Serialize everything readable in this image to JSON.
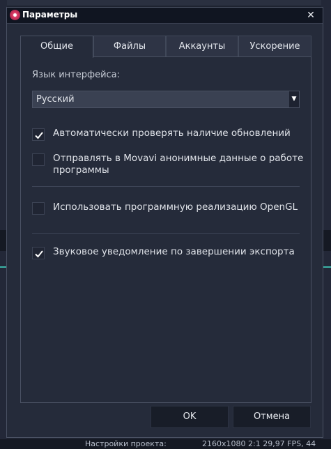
{
  "background": {
    "status_label": "Настройки проекта:",
    "status_value": "2160x1080 2:1 29,97 FPS, 44"
  },
  "dialog": {
    "title": "Параметры",
    "icons": {
      "app": "movavi-logo-icon",
      "close": "close-icon"
    }
  },
  "tabs": [
    {
      "label": "Общие",
      "active": true
    },
    {
      "label": "Файлы",
      "active": false
    },
    {
      "label": "Аккаунты",
      "active": false
    },
    {
      "label": "Ускорение",
      "active": false
    }
  ],
  "general": {
    "language_label": "Язык интерфейса:",
    "language_value": "Русский",
    "options": [
      {
        "label": "Автоматически проверять наличие обновлений",
        "checked": true
      },
      {
        "label": "Отправлять в Movavi анонимные данные о работе программы",
        "checked": false
      },
      {
        "label": "Использовать программную реализацию OpenGL",
        "checked": false
      },
      {
        "label": "Звуковое уведомление по завершении экспорта",
        "checked": true
      }
    ]
  },
  "buttons": {
    "ok": "OK",
    "cancel": "Отмена"
  },
  "colors": {
    "window_bg": "#252b3a",
    "titlebar_bg": "#101521",
    "accent_logo": "#e23c68",
    "button_bg": "#181d28"
  }
}
